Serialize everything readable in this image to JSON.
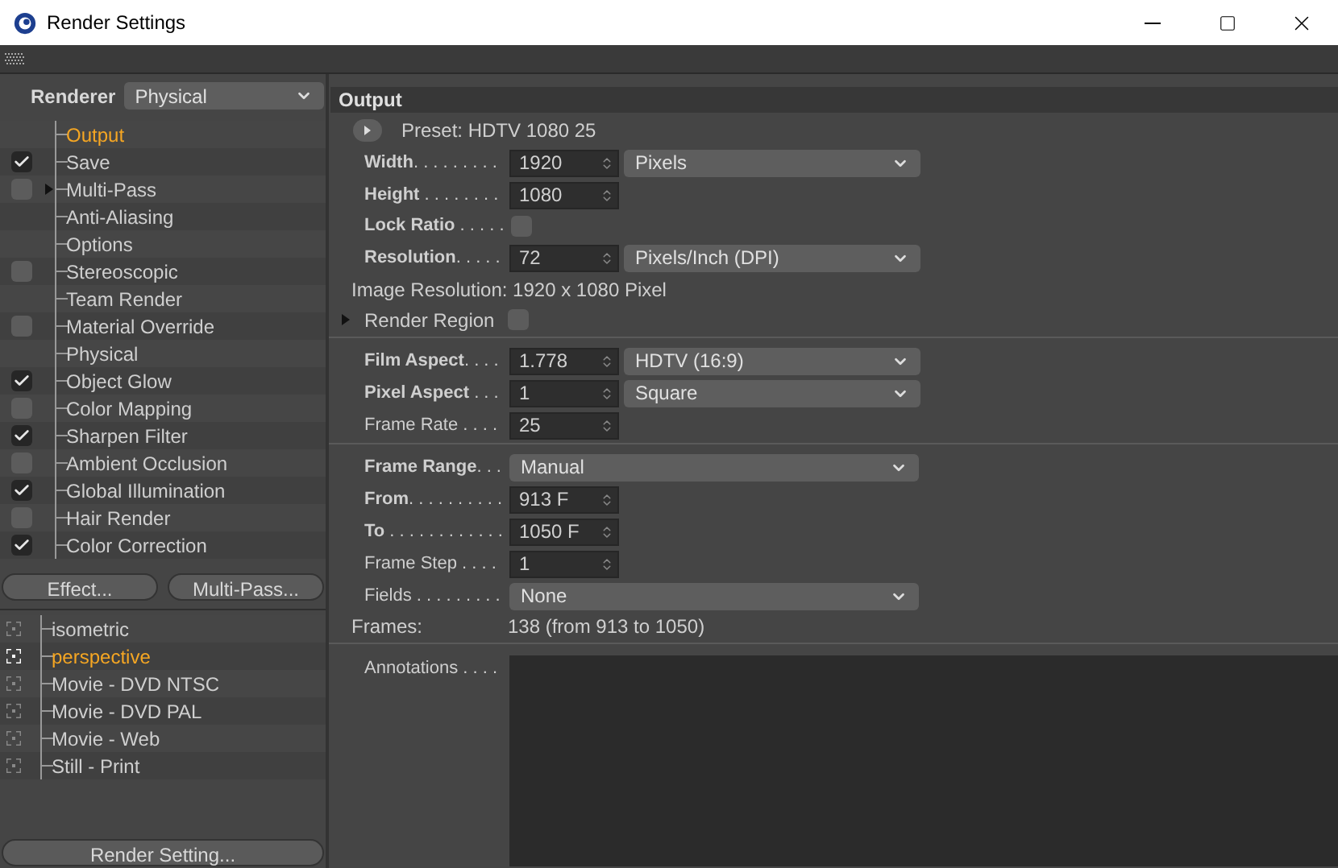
{
  "window": {
    "title": "Render Settings"
  },
  "renderer": {
    "label": "Renderer",
    "value": "Physical"
  },
  "tree": [
    {
      "label": "Output",
      "kind": "plain",
      "selected": true
    },
    {
      "label": "Save",
      "kind": "toggle",
      "checked": true,
      "selected": false
    },
    {
      "label": "Multi-Pass",
      "kind": "toggle",
      "checked": false,
      "selected": false,
      "expanded": false
    },
    {
      "label": "Anti-Aliasing",
      "kind": "plain",
      "selected": false
    },
    {
      "label": "Options",
      "kind": "plain",
      "selected": false
    },
    {
      "label": "Stereoscopic",
      "kind": "toggle",
      "checked": false,
      "selected": false
    },
    {
      "label": "Team Render",
      "kind": "plain",
      "selected": false
    },
    {
      "label": "Material Override",
      "kind": "toggle",
      "checked": false,
      "selected": false
    },
    {
      "label": "Physical",
      "kind": "plain",
      "selected": false
    },
    {
      "label": "Object Glow",
      "kind": "toggle",
      "checked": true,
      "selected": false
    },
    {
      "label": "Color Mapping",
      "kind": "toggle",
      "checked": false,
      "selected": false
    },
    {
      "label": "Sharpen Filter",
      "kind": "toggle",
      "checked": true,
      "selected": false
    },
    {
      "label": "Ambient Occlusion",
      "kind": "toggle",
      "checked": false,
      "selected": false
    },
    {
      "label": "Global Illumination",
      "kind": "toggle",
      "checked": true,
      "selected": false
    },
    {
      "label": "Hair Render",
      "kind": "toggle",
      "checked": false,
      "selected": false
    },
    {
      "label": "Color Correction",
      "kind": "toggle",
      "checked": true,
      "selected": false
    }
  ],
  "buttons": [
    "Effect...",
    "Multi-Pass..."
  ],
  "presets": [
    {
      "label": "isometric",
      "selected": false
    },
    {
      "label": "perspective",
      "selected": true
    },
    {
      "label": "Movie - DVD NTSC",
      "selected": false
    },
    {
      "label": "Movie - DVD PAL",
      "selected": false
    },
    {
      "label": "Movie - Web",
      "selected": false
    },
    {
      "label": "Still - Print",
      "selected": false
    }
  ],
  "render_button": "Render Setting...",
  "panel": {
    "title": "Output",
    "sections": [
      [
        {
          "kind": "preset",
          "label": "Preset: HDTV 1080 25"
        },
        {
          "kind": "field",
          "label": "**Width**. . . . . . . . .",
          "value": "1920",
          "unit": "Pixels"
        },
        {
          "kind": "field",
          "label": "**Height** . . . . . . . .",
          "value": "1080"
        },
        {
          "kind": "checkbox",
          "label": "**Lock Ratio** . . . . .",
          "checked": false
        },
        {
          "kind": "field",
          "label": "**Resolution**. . . . .",
          "value": "72",
          "unit": "Pixels/Inch (DPI)"
        },
        {
          "kind": "info",
          "label": "Image Resolution: 1920 x 1080 Pixel"
        },
        {
          "kind": "group",
          "label": "Render Region",
          "checked": false,
          "expanded": false
        }
      ],
      [
        {
          "kind": "field",
          "label": "**Film Aspect**. . . .",
          "value": "1.778",
          "unit": "HDTV (16:9)"
        },
        {
          "kind": "field",
          "label": "**Pixel Aspect** . . .",
          "value": "1",
          "unit": "Square"
        },
        {
          "kind": "field",
          "label": "Frame Rate . . . .",
          "value": "25"
        }
      ],
      [
        {
          "kind": "select",
          "label": "**Frame Range**. . .",
          "value": "Manual"
        },
        {
          "kind": "field",
          "label": "**From**. . . . . . . . . .",
          "value": "913 F"
        },
        {
          "kind": "field",
          "label": "**To** . . . . . . . . . . . .",
          "value": "1050 F"
        },
        {
          "kind": "field",
          "label": "Frame Step . . . .",
          "value": "1"
        },
        {
          "kind": "select",
          "label": "Fields . . . . . . . . .",
          "value": "None"
        },
        {
          "kind": "stat",
          "label": "Frames:",
          "value": "138 (from 913 to 1050)"
        }
      ],
      [
        {
          "kind": "textarea",
          "label": "Annotations . . . ."
        }
      ]
    ]
  }
}
